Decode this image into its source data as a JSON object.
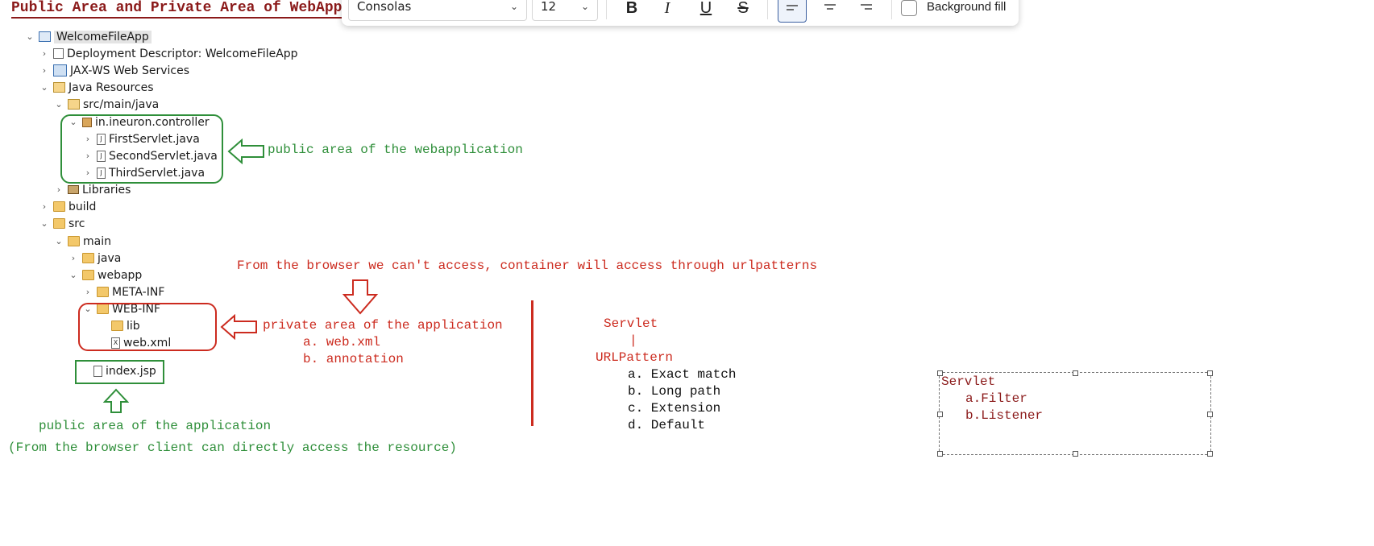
{
  "title": "Public Area and Private Area of WebApplic",
  "toolbar": {
    "font_family": "Consolas",
    "font_size": "12",
    "bold": "B",
    "italic": "I",
    "underline": "U",
    "strike": "S",
    "background_fill_label": "Background fill"
  },
  "tree": [
    {
      "label": "WelcomeFileApp"
    },
    {
      "label": "Deployment Descriptor: WelcomeFileApp"
    },
    {
      "label": "JAX-WS Web Services"
    },
    {
      "label": "Java Resources"
    },
    {
      "label": "src/main/java"
    },
    {
      "label": "in.ineuron.controller"
    },
    {
      "label": "FirstServlet.java"
    },
    {
      "label": "SecondServlet.java"
    },
    {
      "label": "ThirdServlet.java"
    },
    {
      "label": "Libraries"
    },
    {
      "label": "build"
    },
    {
      "label": "src"
    },
    {
      "label": "main"
    },
    {
      "label": "java"
    },
    {
      "label": "webapp"
    },
    {
      "label": "META-INF"
    },
    {
      "label": "WEB-INF"
    },
    {
      "label": "lib"
    },
    {
      "label": "web.xml"
    },
    {
      "label": "index.jsp"
    }
  ],
  "annotations": {
    "public_webapp": "public area of the webapplication",
    "browser_note": "From the browser we can't access, container will access through urlpatterns",
    "private_area": "private area of the application",
    "private_a": "a. web.xml",
    "private_b": "b. annotation",
    "public_app": "public area of the application",
    "public_app_sub": "(From the browser client can directly access the resource)"
  },
  "servlet_list": {
    "servlet": "Servlet",
    "pipe": "|",
    "urlpattern": "URLPattern",
    "items": [
      "a. Exact match",
      "b. Long path",
      "c. Extension",
      "d. Default"
    ]
  },
  "textbox": {
    "heading": "Servlet",
    "items": [
      "a.Filter",
      "b.Listener"
    ]
  },
  "colors": {
    "green": "#2f8f3a",
    "red": "#cc2b1f",
    "maroon": "#8b1a1a"
  }
}
